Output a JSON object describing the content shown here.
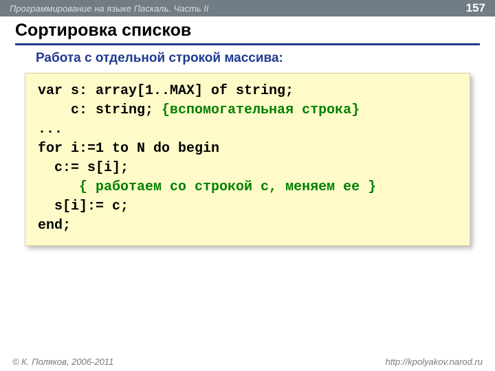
{
  "header": {
    "course": "Программирование на языке Паскаль. Часть II",
    "page_number": "157"
  },
  "title": "Сортировка списков",
  "subtitle": "Работа с отдельной строкой массива:",
  "code": {
    "l1a": "var s: array[1..MAX] of string;",
    "l2a": "    c: string; ",
    "l2b": "{вспомогательная строка}",
    "l3a": "...",
    "l4a": "for i:=1 to N do begin",
    "l5a": "  c:= s[i];",
    "l6a": "     ",
    "l6b": "{ работаем со строкой с, меняем ее }",
    "l7a": "  s[i]:= c;",
    "l8a": "end;"
  },
  "footer": {
    "copyright": "© К. Поляков, 2006-2011",
    "url": "http://kpolyakov.narod.ru"
  }
}
